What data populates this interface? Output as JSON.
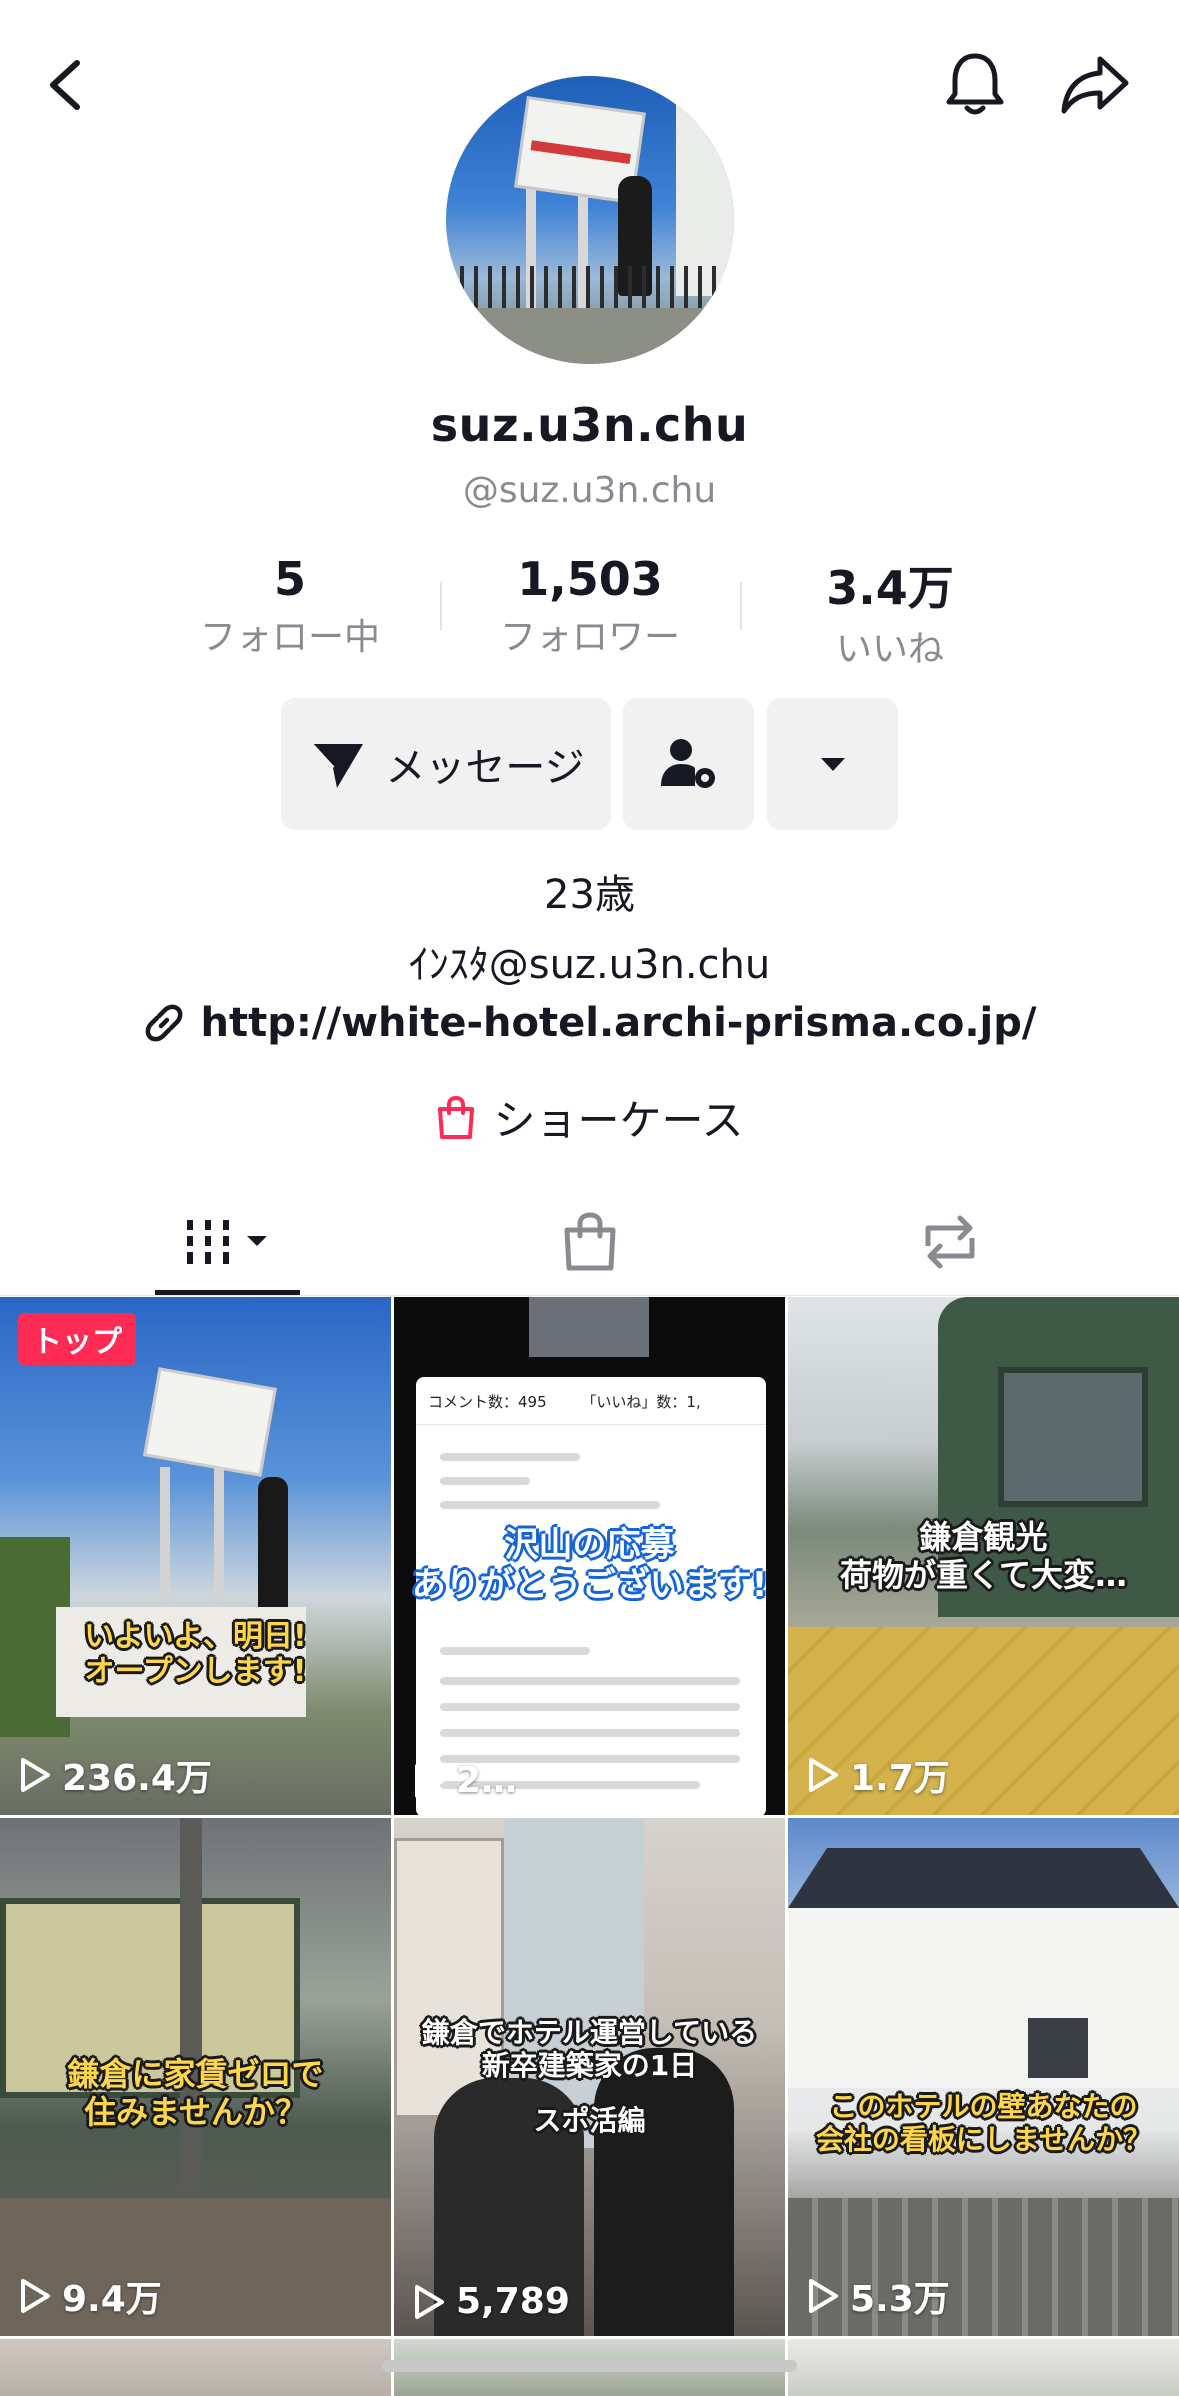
{
  "profile": {
    "display_name": "suz.u3n.chu",
    "handle": "@suz.u3n.chu",
    "stats": [
      {
        "value": "5",
        "label": "フォロー中"
      },
      {
        "value": "1,503",
        "label": "フォロワー"
      },
      {
        "value": "3.4万",
        "label": "いいね"
      }
    ],
    "message_button": "メッセージ",
    "bio_lines": [
      "23歳",
      "ｲﾝｽﾀ@suz.u3n.chu"
    ],
    "link": "http://white-hotel.archi-prisma.co.jp/",
    "showcase": "ショーケース"
  },
  "colors": {
    "accent": "#fe2c55",
    "text_primary": "#161823",
    "text_secondary": "#8a8b91",
    "button_bg": "#f1f1f2"
  },
  "icons": {
    "back": "chevron-left-icon",
    "notifications": "bell-icon",
    "share": "share-arrow-icon",
    "message": "send-icon",
    "friend_settings": "user-gear-icon",
    "more": "caret-down-icon",
    "link": "link-icon",
    "showcase": "shopping-bag-icon",
    "tab_videos": "grid-columns-icon",
    "tab_shop": "shopping-bag-icon",
    "tab_repost": "repost-icon",
    "play": "play-outline-icon"
  },
  "grid": {
    "videos": [
      {
        "views": "236.4万",
        "badge": "トップ",
        "caption": [
          "いよいよ、明日!",
          "オープンします!"
        ]
      },
      {
        "views": "2…",
        "panel_header": "コメント数：495",
        "panel_header_right": "「いいね」数：1,",
        "caption": [
          "沢山の応募",
          "ありがとうございます!"
        ]
      },
      {
        "views": "1.7万",
        "caption": [
          "鎌倉観光",
          "荷物が重くて大変…"
        ]
      },
      {
        "views": "9.4万",
        "caption": [
          "鎌倉に家賃ゼロで",
          "住みませんか？"
        ]
      },
      {
        "views": "5,789",
        "caption": [
          "鎌倉でホテル運営している",
          "新卒建築家の1日",
          "スポ活編"
        ]
      },
      {
        "views": "5.3万",
        "caption": [
          "このホテルの壁あなたの",
          "会社の看板にしませんか？"
        ]
      }
    ]
  }
}
